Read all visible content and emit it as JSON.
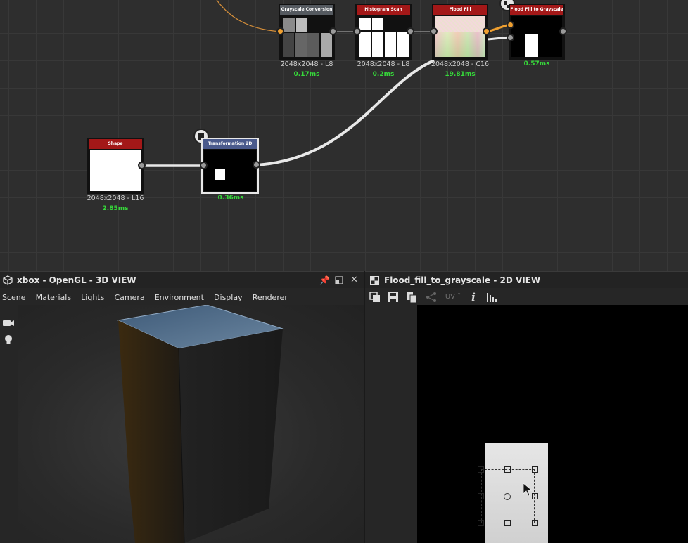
{
  "graph": {
    "nodes": {
      "grayscale": {
        "title": "Grayscale Conversion",
        "res": "2048x2048 - L8",
        "time": "0.17ms"
      },
      "histogram": {
        "title": "Histogram Scan",
        "res": "2048x2048 - L8",
        "time": "0.2ms"
      },
      "flood": {
        "title": "Flood Fill",
        "res": "2048x2048 - C16",
        "time": "19.81ms"
      },
      "floodgray": {
        "title": "Flood Fill to Grayscale",
        "res": "",
        "time": "0.57ms"
      },
      "shape": {
        "title": "Shape",
        "res": "2048x2048 - L16",
        "time": "2.85ms"
      },
      "transform": {
        "title": "Transformation 2D",
        "res": "",
        "time": "0.36ms"
      }
    },
    "colors": {
      "accent": "#f0a030",
      "time_green": "#36d83a",
      "header_red": "#a31818"
    }
  },
  "view3d": {
    "title": "xbox - OpenGL - 3D VIEW",
    "icon": "cube-icon",
    "menu": [
      "Scene",
      "Materials",
      "Lights",
      "Camera",
      "Environment",
      "Display",
      "Renderer"
    ],
    "tools": [
      "camera-icon",
      "light-bulb-icon"
    ]
  },
  "view2d": {
    "title": "Flood_fill_to_grayscale - 2D VIEW",
    "icon": "checker-icon",
    "uv_label": "UV",
    "info_label": "i"
  }
}
